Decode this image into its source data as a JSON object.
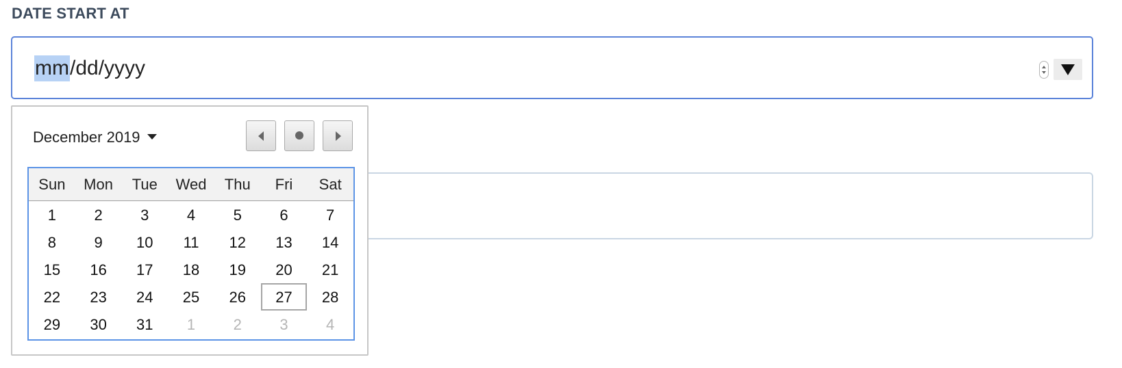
{
  "field": {
    "label": "DATE START AT",
    "segments": {
      "month": "mm",
      "sep1": "/",
      "day": "dd",
      "sep2": "/",
      "year": "yyyy"
    }
  },
  "calendar": {
    "month_label": "December 2019",
    "weekdays": [
      "Sun",
      "Mon",
      "Tue",
      "Wed",
      "Thu",
      "Fri",
      "Sat"
    ],
    "weeks": [
      [
        {
          "d": "1"
        },
        {
          "d": "2"
        },
        {
          "d": "3"
        },
        {
          "d": "4"
        },
        {
          "d": "5"
        },
        {
          "d": "6"
        },
        {
          "d": "7"
        }
      ],
      [
        {
          "d": "8"
        },
        {
          "d": "9"
        },
        {
          "d": "10"
        },
        {
          "d": "11"
        },
        {
          "d": "12"
        },
        {
          "d": "13"
        },
        {
          "d": "14"
        }
      ],
      [
        {
          "d": "15"
        },
        {
          "d": "16"
        },
        {
          "d": "17"
        },
        {
          "d": "18"
        },
        {
          "d": "19"
        },
        {
          "d": "20"
        },
        {
          "d": "21"
        }
      ],
      [
        {
          "d": "22"
        },
        {
          "d": "23"
        },
        {
          "d": "24"
        },
        {
          "d": "25"
        },
        {
          "d": "26"
        },
        {
          "d": "27",
          "today": true
        },
        {
          "d": "28"
        }
      ],
      [
        {
          "d": "29"
        },
        {
          "d": "30"
        },
        {
          "d": "31"
        },
        {
          "d": "1",
          "other": true
        },
        {
          "d": "2",
          "other": true
        },
        {
          "d": "3",
          "other": true
        },
        {
          "d": "4",
          "other": true
        }
      ]
    ]
  },
  "icons": {
    "spinner": "stepper-icon",
    "dropdown": "triangle-down-icon",
    "prev": "triangle-left-icon",
    "today": "dot-icon",
    "next": "triangle-right-icon"
  }
}
